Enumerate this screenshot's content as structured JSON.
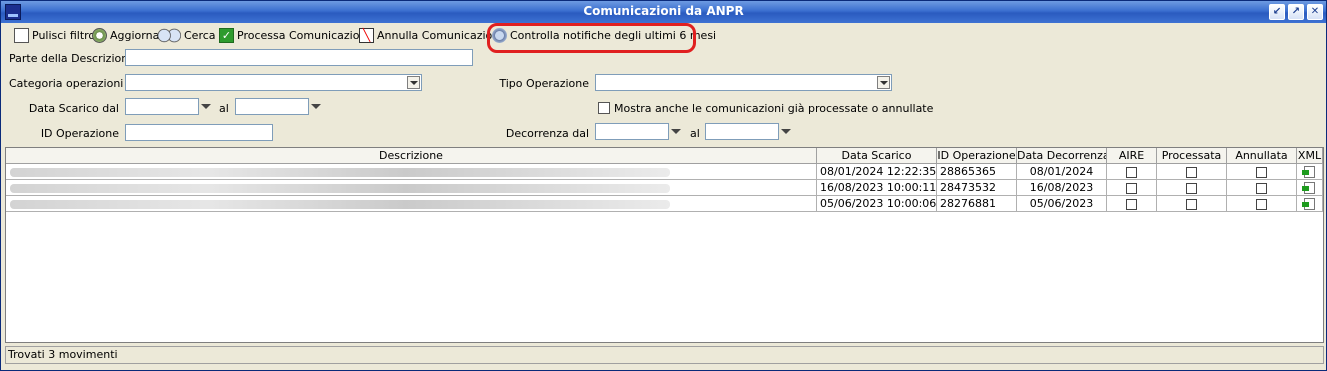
{
  "window": {
    "title": "Comunicazioni da ANPR"
  },
  "toolbar": {
    "items": [
      {
        "label": "Pulisci filtro",
        "icon": "document-icon"
      },
      {
        "label": "Aggiorna",
        "icon": "refresh-icon"
      },
      {
        "label": "Cerca",
        "icon": "binoculars-icon"
      },
      {
        "label": "Processa Comunicazione",
        "icon": "checkmark-icon"
      },
      {
        "label": "Annulla Comunicazione",
        "icon": "cancel-icon"
      },
      {
        "label": "Controlla notifiche degli ultimi 6 mesi",
        "icon": "notification-icon"
      }
    ],
    "highlight_color": "#e02020"
  },
  "filters": {
    "descrizione_label": "Parte della Descrizione",
    "descrizione_value": "",
    "categoria_label": "Categoria operazioni",
    "categoria_value": "",
    "tipo_label": "Tipo Operazione",
    "tipo_value": "",
    "data_scarico_label": "Data Scarico dal",
    "data_scarico_from": "",
    "data_scarico_al_label": "al",
    "data_scarico_to": "",
    "mostra_label": "Mostra anche le comunicazioni già processate o annullate",
    "mostra_checked": false,
    "id_operazione_label": "ID Operazione",
    "id_operazione_value": "",
    "decorrenza_label": "Decorrenza dal",
    "decorrenza_from": "",
    "decorrenza_al_label": "al",
    "decorrenza_to": ""
  },
  "grid": {
    "columns": [
      "Descrizione",
      "Data Scarico",
      "ID Operazione",
      "Data Decorrenza",
      "AIRE",
      "Processata",
      "Annullata",
      "XML"
    ],
    "rows": [
      {
        "data_scarico": "08/01/2024 12:22:35",
        "id_operazione": "28865365",
        "data_decorrenza": "08/01/2024",
        "aire": false,
        "processata": false,
        "annullata": false
      },
      {
        "data_scarico": "16/08/2023 10:00:11",
        "id_operazione": "28473532",
        "data_decorrenza": "16/08/2023",
        "aire": false,
        "processata": false,
        "annullata": false
      },
      {
        "data_scarico": "05/06/2023 10:00:06",
        "id_operazione": "28276881",
        "data_decorrenza": "05/06/2023",
        "aire": false,
        "processata": false,
        "annullata": false
      }
    ]
  },
  "status": {
    "text": "Trovati 3 movimenti"
  }
}
